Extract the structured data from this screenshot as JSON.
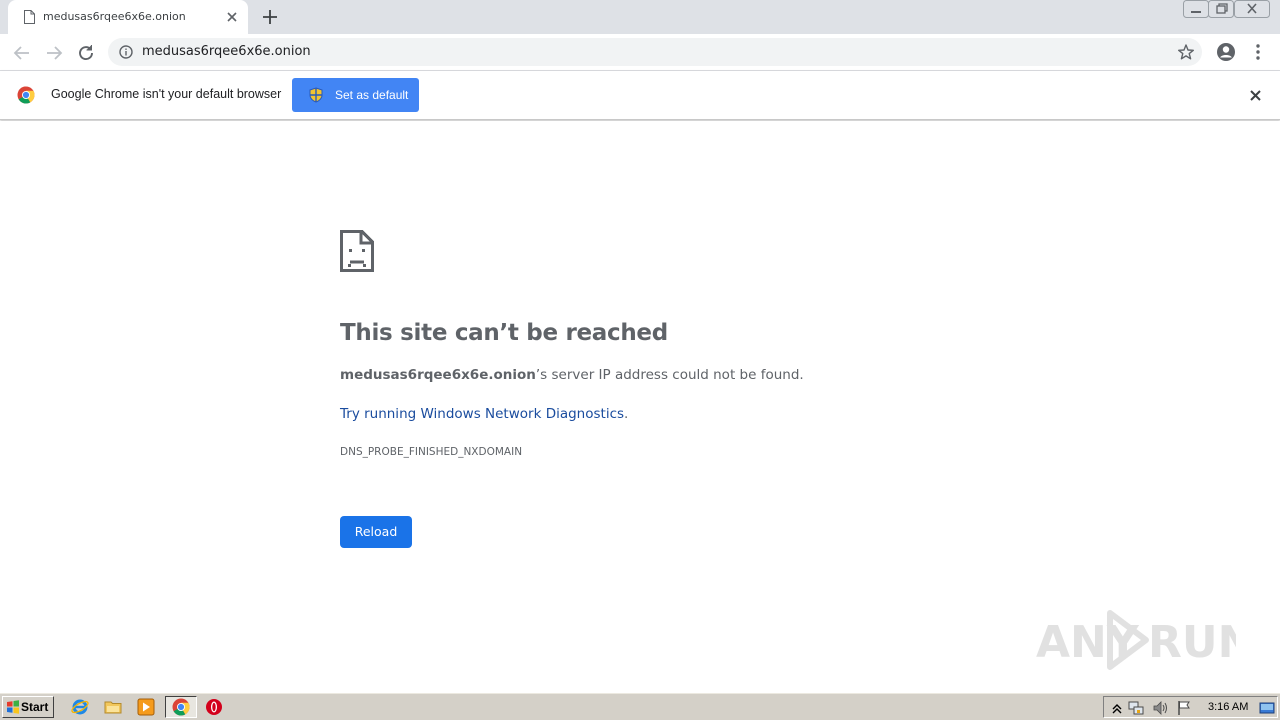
{
  "browser": {
    "tab": {
      "title": "medusas6rqee6x6e.onion"
    },
    "address_bar": {
      "url": "medusas6rqee6x6e.onion"
    }
  },
  "infobar": {
    "message": "Google Chrome isn't your default browser",
    "set_default_label": "Set as default"
  },
  "error_page": {
    "title": "This site can’t be reached",
    "host": "medusas6rqee6x6e.onion",
    "description_suffix": "’s server IP address could not be found.",
    "diagnostics_link": "Try running Windows Network Diagnostics",
    "diagnostics_link_period": ".",
    "error_code": "DNS_PROBE_FINISHED_NXDOMAIN",
    "reload_label": "Reload"
  },
  "watermark": {
    "text_left": "ANY",
    "text_right": "RUN"
  },
  "taskbar": {
    "start_label": "Start",
    "clock": "3:16 AM",
    "pinned": [
      "internet-explorer-icon",
      "folder-icon",
      "media-player-icon",
      "chrome-icon",
      "opera-icon"
    ]
  },
  "colors": {
    "accent_blue": "#4285f4",
    "reload_blue": "#1a73e8",
    "link_blue": "#1a4c9e",
    "error_text": "#5f6368",
    "tabstrip_bg": "#dee1e6",
    "taskbar_bg": "#d4d0c8"
  }
}
